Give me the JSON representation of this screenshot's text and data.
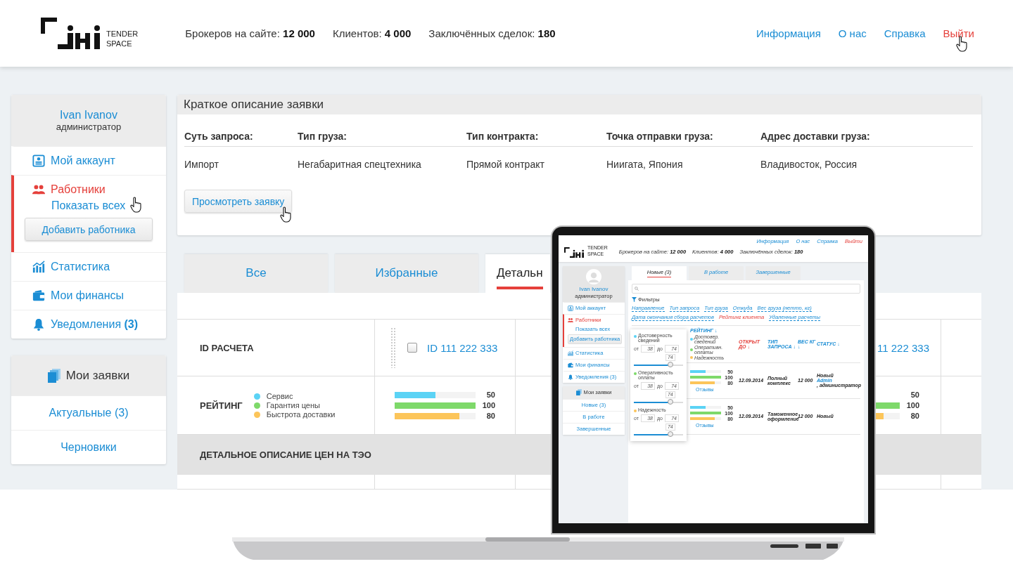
{
  "header": {
    "logo": {
      "line_1": "TENDER",
      "line_2": "SPACE"
    },
    "stats": [
      {
        "label": "Брокеров на сайте:",
        "value": "12 000"
      },
      {
        "label": "Клиентов:",
        "value": "4 000"
      },
      {
        "label": "Заключённых сделок:",
        "value": "180"
      }
    ],
    "nav": [
      {
        "label": "Информация",
        "selected": false
      },
      {
        "label": "О нас",
        "selected": false
      },
      {
        "label": "Справка",
        "selected": false
      },
      {
        "label": "Выйти",
        "selected": true
      }
    ]
  },
  "sidebar": {
    "user": {
      "name": "Ivan Ivanov",
      "role": "администратор"
    },
    "menu": [
      {
        "label": "Мой аккаунт",
        "kind": "account",
        "selected": false
      },
      {
        "label": "Работники",
        "kind": "workers",
        "selected": true,
        "sub_link": "Показать всех",
        "sub_button": "Добавить работника"
      },
      {
        "label": "Статистика",
        "kind": "stats",
        "selected": false
      },
      {
        "label": "Мои финансы",
        "kind": "wallet",
        "selected": false
      },
      {
        "label": "Уведомления",
        "count": "(3)",
        "kind": "bell",
        "selected": false
      }
    ],
    "requests": {
      "title": "Мои заявки",
      "items": [
        "Актуальные (3)",
        "Черновики"
      ]
    }
  },
  "summary": {
    "title": "Краткое описание заявки",
    "columns": [
      {
        "label": "Суть запроса:",
        "value": "Импорт"
      },
      {
        "label": "Тип груза:",
        "value": "Негабаритная спецтехника"
      },
      {
        "label": "Тип контракта:",
        "value": "Прямой контракт"
      },
      {
        "label": "Точка отправки груза:",
        "value": "Ниигата, Япония"
      },
      {
        "label": "Адрес доставки груза:",
        "value": "Владивосток, Россия"
      }
    ],
    "button": "Просмотреть заявку"
  },
  "tabs": [
    {
      "label": "Все",
      "selected": false
    },
    {
      "label": "Избранные",
      "selected": false
    },
    {
      "label": "Детальн",
      "selected": true
    }
  ],
  "table": {
    "id_label": "ID РАСЧЕТА",
    "rating_label": "РЕЙТИНГ",
    "legend": [
      {
        "label": "Сервис",
        "color": "#5bd3f5"
      },
      {
        "label": "Гарантия цены",
        "color": "#7ed96a"
      },
      {
        "label": "Быстрота доставки",
        "color": "#fcc55a"
      }
    ],
    "offers": [
      {
        "id": "ID 111 222 333",
        "checked": false,
        "ratings": [
          {
            "level": 0.5,
            "reading": "50"
          },
          {
            "level": 1,
            "reading": "100"
          },
          {
            "level": 0.8,
            "reading": "80"
          }
        ]
      },
      {
        "id": "11 222 333",
        "ratings": [
          {
            "reading": "50"
          },
          {
            "level": 1,
            "reading": "100"
          },
          {
            "level": 0.8,
            "reading": "80"
          }
        ]
      }
    ],
    "section_title": "ДЕТАЛЬНОЕ ОПИСАНИЕ ЦЕН НА ТЭО"
  },
  "laptop_screen": {
    "logo": {
      "line_1": "TENDER",
      "line_2": "SPACE"
    },
    "stats": [
      {
        "label": "Брокеров на сайте:",
        "value": "12 000"
      },
      {
        "label": "Клиентов:",
        "value": "4 000"
      },
      {
        "label": "Заключённых сделок:",
        "value": "180"
      }
    ],
    "nav": [
      {
        "label": "Информация",
        "selected": false
      },
      {
        "label": "О нас",
        "selected": false
      },
      {
        "label": "Справка",
        "selected": false
      },
      {
        "label": "Выйти",
        "selected": true
      }
    ],
    "user": {
      "name": "Ivan Ivanov",
      "role": "администратор"
    },
    "menu": [
      {
        "label": "Мой аккаунт",
        "kind": "account",
        "selected": false
      },
      {
        "label": "Работники",
        "kind": "workers",
        "selected": true,
        "sub_link": "Показать всех",
        "sub_button": "Добавить работника"
      },
      {
        "label": "Статистика",
        "kind": "stats",
        "selected": false
      },
      {
        "label": "Мои финансы",
        "kind": "wallet",
        "selected": false
      },
      {
        "label": "Уведомления (3)",
        "kind": "bell",
        "selected": false
      }
    ],
    "requests": {
      "title": "Мои заявки",
      "items": [
        "Новые (3)",
        "В работе",
        "Завершенные"
      ]
    },
    "tabs": [
      {
        "label": "Новые (3)",
        "selected": true
      },
      {
        "label": "В работе",
        "selected": false
      },
      {
        "label": "Завершенные",
        "selected": false
      }
    ],
    "filters_label": "Фильтры",
    "filters": [
      {
        "label": "Направление",
        "selected": false
      },
      {
        "label": "Тип запроса",
        "selected": false
      },
      {
        "label": "Тип груза",
        "selected": false
      },
      {
        "label": "Откуда",
        "selected": false
      },
      {
        "label": "Вес груза (нетто, кг)",
        "selected": false
      },
      {
        "label": "Дата окончания сбора расчетов",
        "selected": false
      },
      {
        "label": "Рейтинг клиента",
        "selected": true
      },
      {
        "label": "Удаленные расчеты",
        "selected": false
      }
    ],
    "filter_panel": [
      {
        "label": "Достоверность сведений",
        "color": "#5bd3f5",
        "from_label": "от",
        "from": "38",
        "to_label": "до",
        "to": "74",
        "tooltip": "74",
        "level": 0.74
      },
      {
        "label": "Оперативность оплаты",
        "color": "#7ed96a",
        "from_label": "от",
        "from": "38",
        "to_label": "до",
        "to": "74",
        "tooltip": "74",
        "level": 0.74
      },
      {
        "label": "Надежность",
        "color": "#fcc55a",
        "from_label": "от",
        "from": "38",
        "to_label": "до",
        "to": "74",
        "tooltip": "74",
        "level": 0.74
      }
    ],
    "columns": [
      {
        "label": "РЕЙТИНГ ↓",
        "selected": false
      },
      {
        "label": "ОТКРЫТ ДО ↓",
        "selected": true
      },
      {
        "label": "ТИП ЗАПРОСА ↓",
        "selected": false
      },
      {
        "label": "ВЕС КГ ↓",
        "selected": false
      },
      {
        "label": "СТАТУС ↓",
        "selected": false
      }
    ],
    "legend": [
      {
        "label": "Достовер. сведений",
        "color": "#5bd3f5"
      },
      {
        "label": "Оперативн. оплаты",
        "color": "#7ed96a"
      },
      {
        "label": "Надежность",
        "color": "#fcc55a"
      }
    ],
    "rows": [
      {
        "ratings": [
          {
            "level": 0.5,
            "reading": "50"
          },
          {
            "level": 1,
            "reading": "100"
          },
          {
            "level": 0.8,
            "reading": "80"
          }
        ],
        "reviews": "Отзывы",
        "date": "12.09.2014",
        "type": "Полный комплекс",
        "weight": "12 000",
        "status": "Новый",
        "author": "Admin",
        "author_role": ", администратор"
      },
      {
        "ratings": [
          {
            "level": 0.5,
            "reading": "50"
          },
          {
            "level": 1,
            "reading": "100"
          },
          {
            "level": 0.8,
            "reading": "80"
          }
        ],
        "reviews": "Отзывы",
        "date": "12.09.2014",
        "type": "Таможенное оформление",
        "weight": "12 000",
        "status": "Новый"
      }
    ]
  }
}
